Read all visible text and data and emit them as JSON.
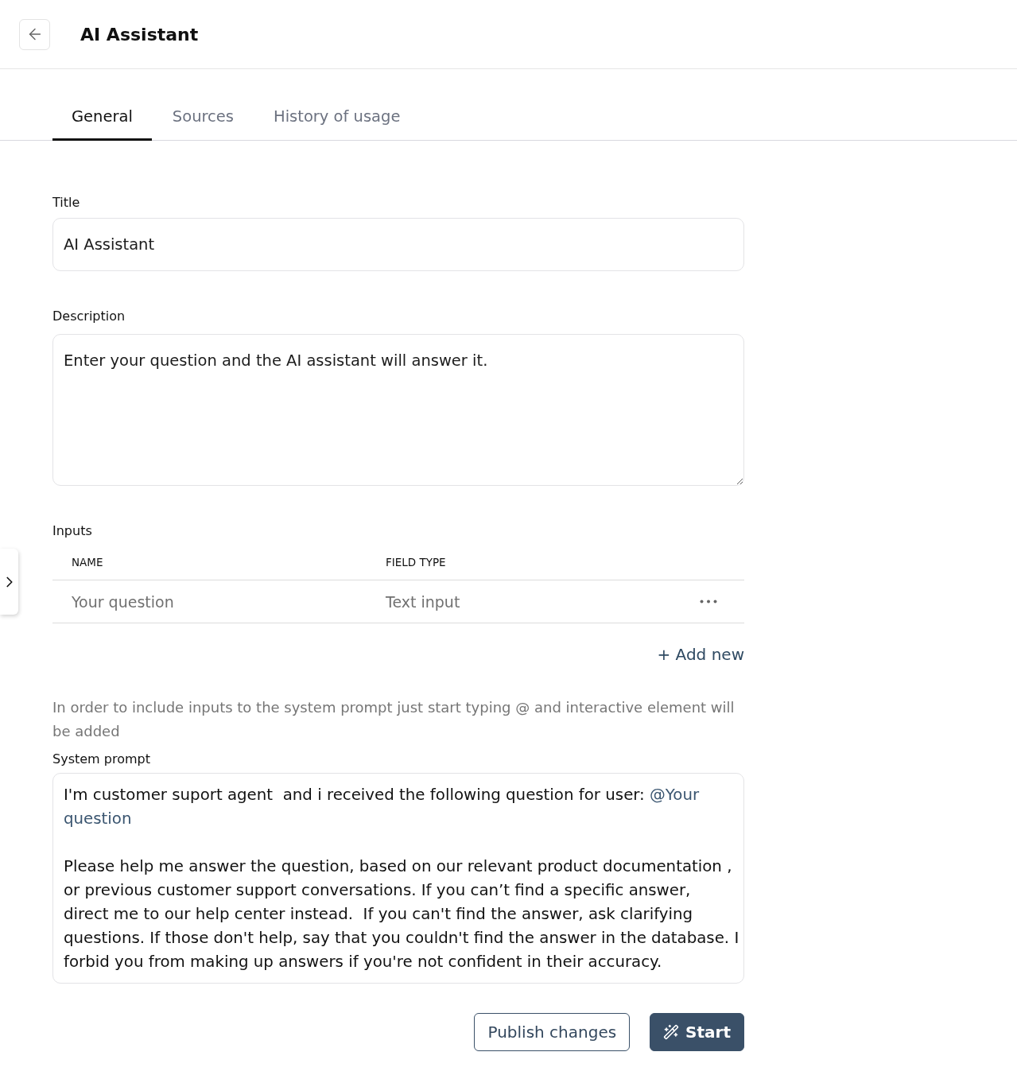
{
  "header": {
    "title": "AI Assistant"
  },
  "tabs": [
    {
      "label": "General",
      "selected": true
    },
    {
      "label": "Sources",
      "selected": false
    },
    {
      "label": "History of usage",
      "selected": false
    }
  ],
  "title_field": {
    "label": "Title",
    "value": "AI Assistant"
  },
  "description_field": {
    "label": "Description",
    "value": "Enter your question and the AI assistant will answer it."
  },
  "inputs": {
    "label": "Inputs",
    "columns": [
      "NAME",
      "FIELD TYPE"
    ],
    "rows": [
      {
        "name": "Your question",
        "field_type": "Text input"
      }
    ],
    "add_new": "+ Add new"
  },
  "hint": "In order to include inputs to the system prompt just start typing @ and interactive element will be added",
  "system_prompt": {
    "label": "System prompt",
    "paragraphs": [
      [
        {
          "kind": "text",
          "text": "I'm customer suport agent  and i received the following question for user: "
        },
        {
          "kind": "mention",
          "text": "@Your question"
        }
      ],
      [
        {
          "kind": "text",
          "text": "Please help me answer the question, based on our relevant product documentation , or previous customer support conversations. If you can’t find a specific answer, direct me to our help center instead.  If you can't find the answer, ask clarifying questions. If those don't help, say that you couldn't find the answer in the database. I forbid you from making up answers if you're not confident in their accuracy."
        }
      ]
    ]
  },
  "actions": [
    {
      "label": "Publish changes",
      "kind": "outline"
    },
    {
      "label": "Start",
      "kind": "primary"
    }
  ]
}
